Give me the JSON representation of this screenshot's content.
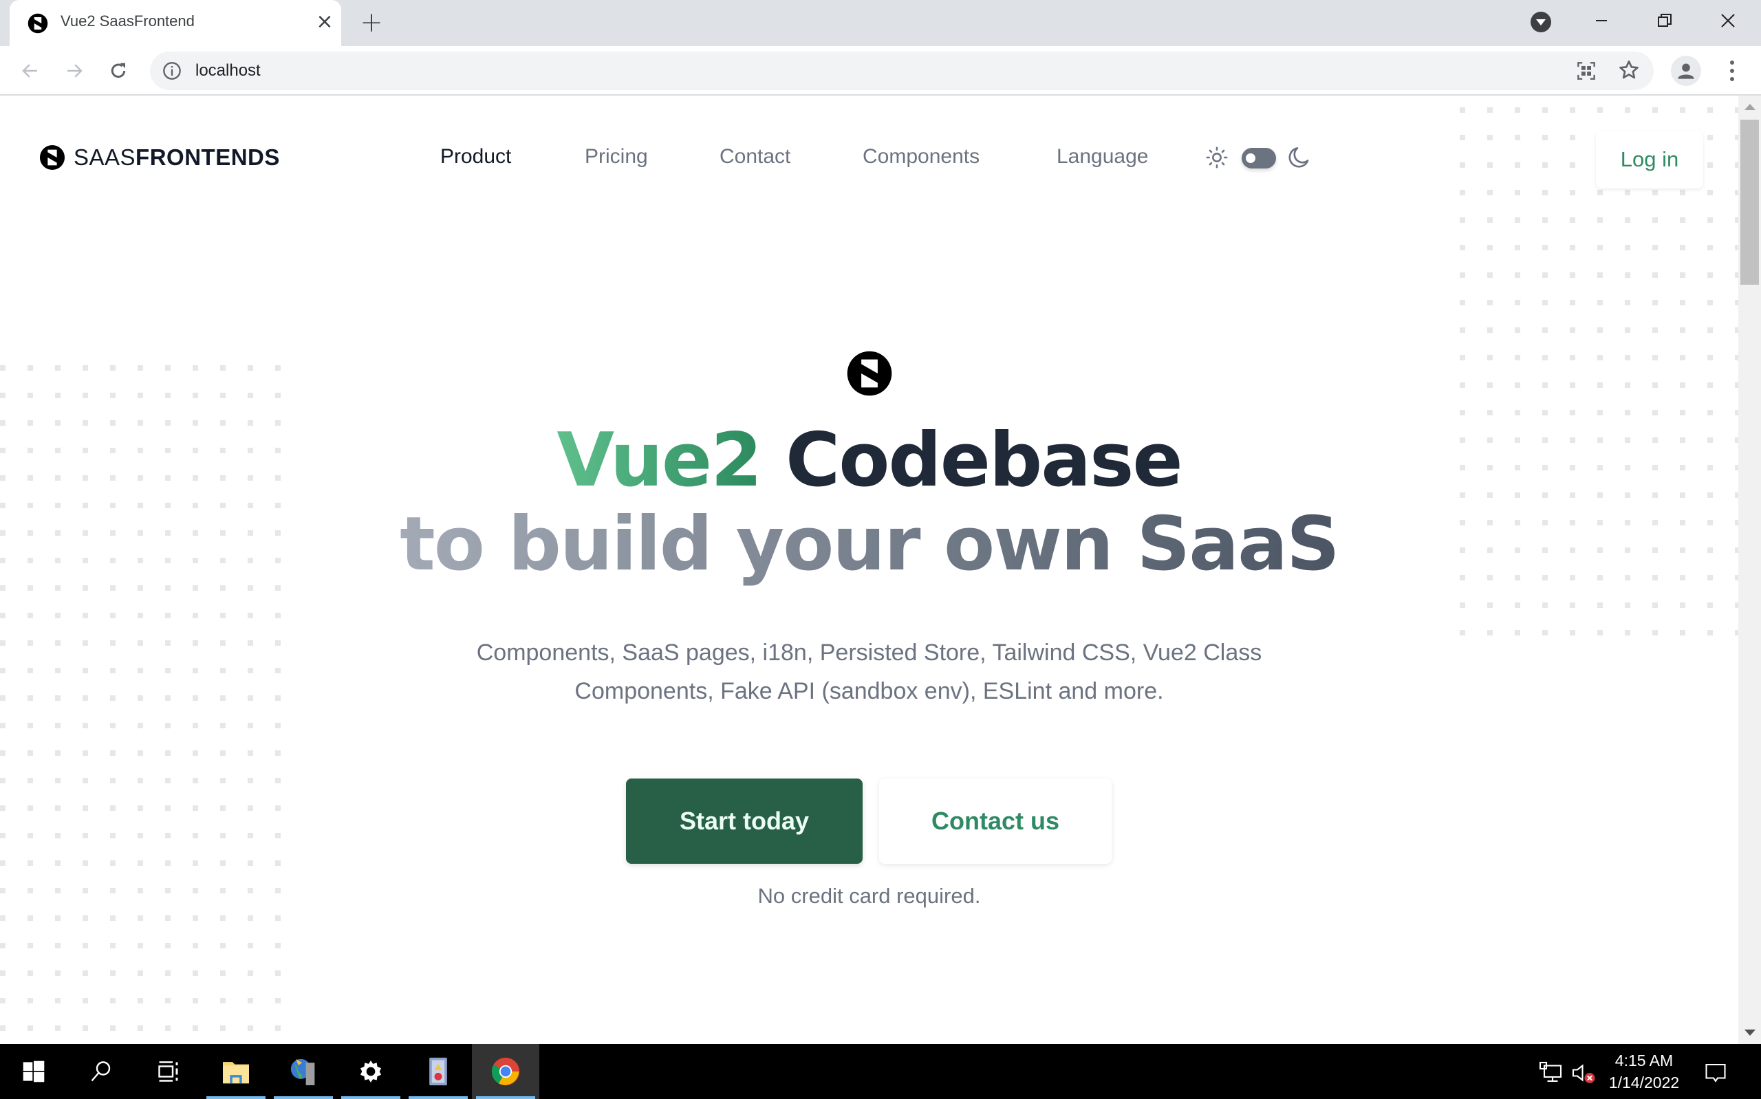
{
  "browser": {
    "tab": {
      "title": "Vue2 SaasFrontend",
      "close_icon": "close-icon"
    },
    "new_tab_label": "+",
    "address_bar": {
      "url": "localhost",
      "site_info_icon": "info-icon"
    },
    "window_controls": [
      "minimize",
      "restore",
      "close"
    ]
  },
  "page": {
    "brand": {
      "light": "SAAS",
      "bold": "FRONTENDS"
    },
    "nav": {
      "items": [
        {
          "label": "Product",
          "active": true
        },
        {
          "label": "Pricing",
          "active": false
        },
        {
          "label": "Contact",
          "active": false
        },
        {
          "label": "Components",
          "active": false
        },
        {
          "label": "Language",
          "active": false
        }
      ],
      "theme_toggle": {
        "state": "light"
      },
      "login_label": "Log in"
    },
    "hero": {
      "headline_accent": "Vue2",
      "headline_rest": "Codebase",
      "headline_line2": "to build your own SaaS",
      "subtitle": "Components, SaaS pages, i18n, Persisted Store, Tailwind CSS, Vue2 Class Components, Fake API (sandbox env), ESLint and more.",
      "primary_cta": "Start today",
      "secondary_cta": "Contact us",
      "note": "No credit card required."
    },
    "colors": {
      "accent": "#2f8a63",
      "primary_button": "#275f47",
      "heading": "#1f2937",
      "muted": "#6b7280",
      "dot_pattern": "#e5e7eb"
    }
  },
  "taskbar": {
    "pinned": [
      "start",
      "search",
      "task-view",
      "file-explorer",
      "network-app",
      "settings",
      "event-viewer",
      "chrome"
    ],
    "time": "4:15 AM",
    "date": "1/14/2022"
  }
}
